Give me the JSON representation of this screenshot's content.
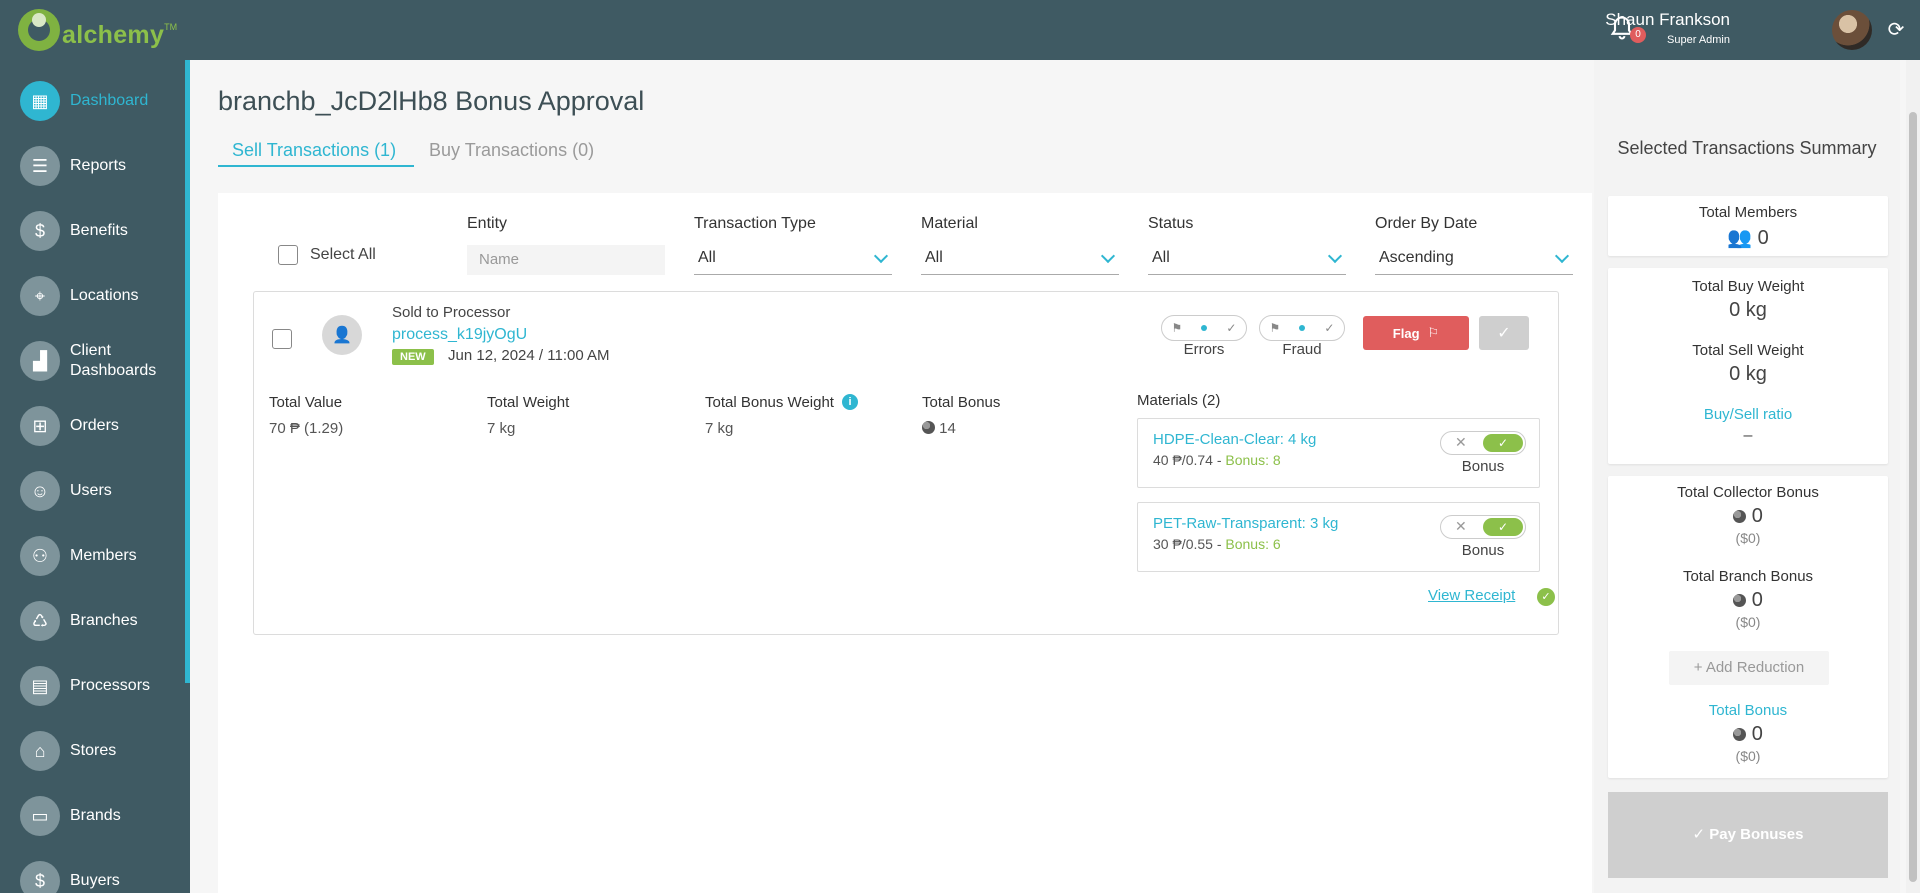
{
  "brand": {
    "name": "alchemy",
    "tm": "TM"
  },
  "header": {
    "notifications_count": "0",
    "user_name": "Shaun Frankson",
    "user_role": "Super Admin"
  },
  "sidebar": {
    "items": [
      {
        "label": "Dashboard",
        "icon": "dashboard-icon",
        "glyph": "▦",
        "active": true
      },
      {
        "label": "Reports",
        "icon": "list-icon",
        "glyph": "☰"
      },
      {
        "label": "Benefits",
        "icon": "dollar-icon",
        "glyph": "$"
      },
      {
        "label": "Locations",
        "icon": "location-pin-icon",
        "glyph": "⌖"
      },
      {
        "label": "Client Dashboards",
        "icon": "chart-icon",
        "glyph": "▟"
      },
      {
        "label": "Orders",
        "icon": "orders-icon",
        "glyph": "⊞"
      },
      {
        "label": "Users",
        "icon": "user-icon",
        "glyph": "☺"
      },
      {
        "label": "Members",
        "icon": "members-icon",
        "glyph": "⚇"
      },
      {
        "label": "Branches",
        "icon": "recycle-icon",
        "glyph": "♺"
      },
      {
        "label": "Processors",
        "icon": "building-icon",
        "glyph": "▤"
      },
      {
        "label": "Stores",
        "icon": "store-icon",
        "glyph": "⌂"
      },
      {
        "label": "Brands",
        "icon": "brand-icon",
        "glyph": "▭"
      },
      {
        "label": "Buyers",
        "icon": "dollar-icon",
        "glyph": "$"
      }
    ]
  },
  "page": {
    "title": "branchb_JcD2lHb8 Bonus Approval",
    "tabs": [
      {
        "label": "Sell Transactions (1)",
        "active": true
      },
      {
        "label": "Buy Transactions (0)",
        "active": false
      }
    ]
  },
  "filters": {
    "select_all": "Select All",
    "entity_label": "Entity",
    "entity_placeholder": "Name",
    "transaction_type_label": "Transaction Type",
    "transaction_type_value": "All",
    "material_label": "Material",
    "material_value": "All",
    "status_label": "Status",
    "status_value": "All",
    "order_label": "Order By Date",
    "order_value": "Ascending"
  },
  "transaction": {
    "type": "Sold to Processor",
    "processor": "process_k19jyOgU",
    "badge": "NEW",
    "date": "Jun 12, 2024 / 11:00 AM",
    "errors_label": "Errors",
    "fraud_label": "Fraud",
    "flag_label": "Flag",
    "total_value_label": "Total Value",
    "total_value": "70 ₱ (1.29)",
    "total_weight_label": "Total Weight",
    "total_weight": "7 kg",
    "total_bonus_weight_label": "Total Bonus Weight",
    "total_bonus_weight": "7 kg",
    "total_bonus_label": "Total Bonus",
    "total_bonus": "14",
    "materials_label": "Materials (2)",
    "materials": [
      {
        "name": "HDPE-Clean-Clear: 4 kg",
        "price": "40 ₱/0.74 - ",
        "bonus": "Bonus: 8",
        "toggle_label": "Bonus"
      },
      {
        "name": "PET-Raw-Transparent: 3 kg",
        "price": "30 ₱/0.55 - ",
        "bonus": "Bonus: 6",
        "toggle_label": "Bonus"
      }
    ],
    "view_receipt": "View Receipt"
  },
  "summary": {
    "title": "Selected Transactions Summary",
    "total_members_label": "Total Members",
    "total_members": "0",
    "total_buy_weight_label": "Total Buy Weight",
    "total_buy_weight": "0 kg",
    "total_sell_weight_label": "Total Sell Weight",
    "total_sell_weight": "0 kg",
    "ratio_label": "Buy/Sell ratio",
    "ratio_value": "–",
    "collector_bonus_label": "Total Collector Bonus",
    "collector_bonus": "0",
    "collector_bonus_usd": "($0)",
    "branch_bonus_label": "Total Branch Bonus",
    "branch_bonus": "0",
    "branch_bonus_usd": "($0)",
    "add_reduction": "+ Add Reduction",
    "total_bonus_label": "Total Bonus",
    "total_bonus": "0",
    "total_bonus_usd": "($0)",
    "pay_button": "✓ Pay Bonuses"
  },
  "colors": {
    "sidebar": "#3f5a63",
    "accent": "#2fb6d1",
    "green": "#8cc04a",
    "red": "#e05d5d"
  }
}
